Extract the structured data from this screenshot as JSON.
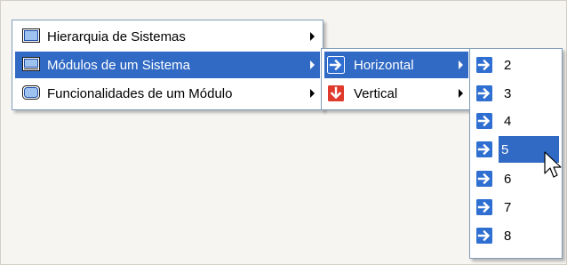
{
  "menu_main": {
    "items": [
      {
        "label": "Hierarquia de Sistemas"
      },
      {
        "label": "Módulos de um Sistema"
      },
      {
        "label": "Funcionalidades de um Módulo"
      }
    ]
  },
  "menu_layout": {
    "items": [
      {
        "label": "Horizontal"
      },
      {
        "label": "Vertical"
      }
    ]
  },
  "menu_levels": {
    "items": [
      {
        "label": "2"
      },
      {
        "label": "3"
      },
      {
        "label": "4"
      },
      {
        "label": "5"
      },
      {
        "label": "6"
      },
      {
        "label": "7"
      },
      {
        "label": "8"
      }
    ]
  },
  "colors": {
    "selection": "#316ac5",
    "border": "#7f9db9",
    "arrow_icon": "#2f6fd1",
    "down_icon": "#e03a2c"
  }
}
